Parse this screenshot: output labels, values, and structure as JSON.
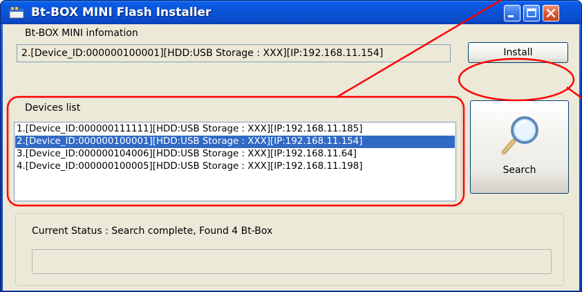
{
  "window": {
    "title": "Bt-BOX MINI Flash Installer",
    "minimize_icon": "minimize-icon",
    "maximize_icon": "maximize-icon",
    "close_icon": "close-icon"
  },
  "info": {
    "label": "Bt-BOX MINI infomation",
    "value": "2.[Device_ID:000000100001][HDD:USB Storage : XXX][IP:192.168.11.154]"
  },
  "install_button": {
    "label": "Install"
  },
  "devices": {
    "label": "Devices list",
    "items": [
      {
        "text": "1.[Device_ID:000000111111][HDD:USB Storage : XXX][IP:192.168.11.185]",
        "selected": false
      },
      {
        "text": "2.[Device_ID:000000100001][HDD:USB Storage : XXX][IP:192.168.11.154]",
        "selected": true
      },
      {
        "text": "3.[Device_ID:000000104006][HDD:USB Storage : XXX][IP:192.168.11.64]",
        "selected": false
      },
      {
        "text": "4.[Device_ID:000000100005][HDD:USB Storage : XXX][IP:192.168.11.198]",
        "selected": false
      }
    ]
  },
  "search_button": {
    "label": "Search",
    "icon": "magnifier-icon"
  },
  "status": {
    "text": "Current Status : Search complete, Found 4 Bt-Box",
    "progress": 0
  },
  "colors": {
    "titlebar": "#0a54da",
    "selection": "#316ac5",
    "annotation": "#ff0000",
    "client_bg": "#ece9d8"
  }
}
